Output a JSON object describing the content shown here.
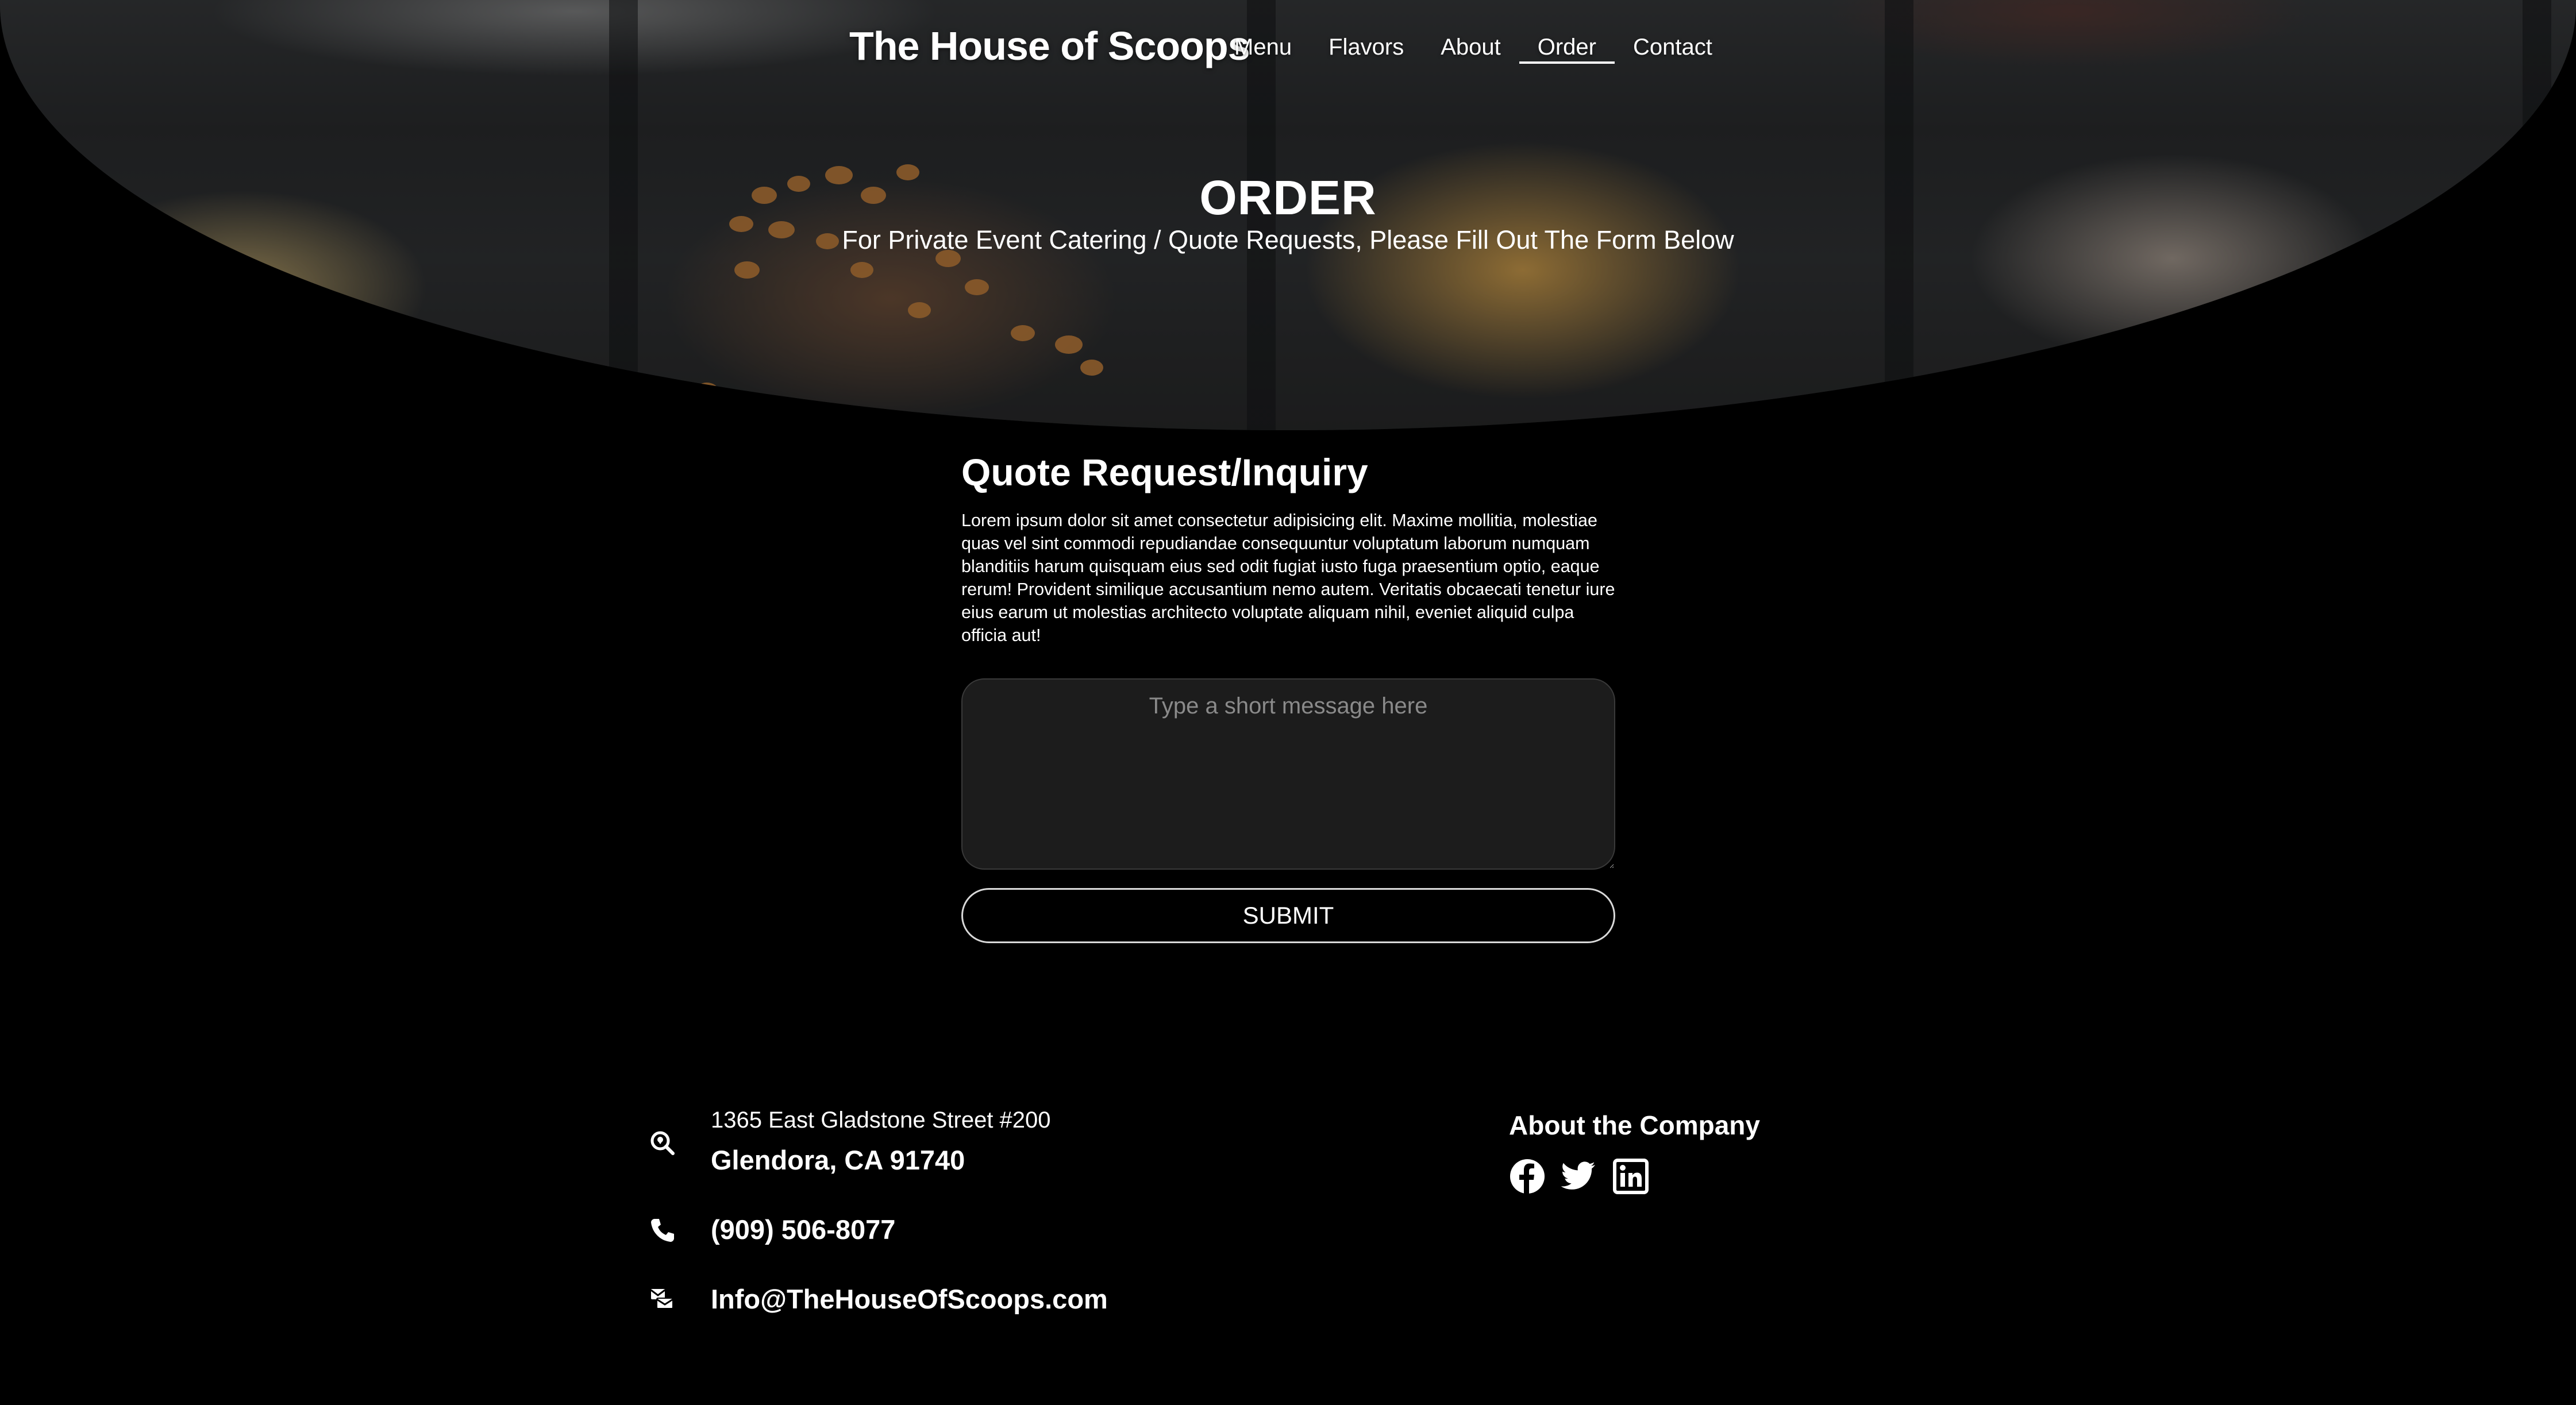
{
  "brand": "The House of Scoops",
  "nav": {
    "items": [
      {
        "label": "Menu"
      },
      {
        "label": "Flavors"
      },
      {
        "label": "About"
      },
      {
        "label": "Order"
      },
      {
        "label": "Contact"
      }
    ],
    "active": "Order"
  },
  "hero": {
    "title": "ORDER",
    "subtitle": "For Private Event Catering / Quote Requests, Please Fill Out The Form Below"
  },
  "form": {
    "heading": "Quote Request/Inquiry",
    "body": "Lorem ipsum dolor sit amet consectetur adipisicing elit. Maxime mollitia, molestiae quas vel sint commodi repudiandae consequuntur voluptatum laborum numquam blanditiis harum quisquam eius sed odit fugiat iusto fuga praesentium optio, eaque rerum! Provident similique accusantium nemo autem. Veritatis obcaecati tenetur iure eius earum ut molestias architecto voluptate aliquam nihil, eveniet aliquid culpa officia aut!",
    "message_placeholder": "Type a short message here",
    "message_value": "",
    "submit_label": "SUBMIT"
  },
  "footer": {
    "address_line1": "1365 East Gladstone Street #200",
    "address_line2": "Glendora, CA 91740",
    "phone": "(909) 506-8077",
    "email": "Info@TheHouseOfScoops.com",
    "about_title": "About the Company",
    "social_icons": [
      "facebook-icon",
      "twitter-icon",
      "linkedin-icon"
    ],
    "contact_icons": [
      "location-search-icon",
      "phone-icon",
      "mail-icon"
    ]
  },
  "colors": {
    "background": "#000000",
    "text": "#ffffff",
    "input_bg": "#1c1c1c",
    "placeholder": "#8a8a8a"
  }
}
